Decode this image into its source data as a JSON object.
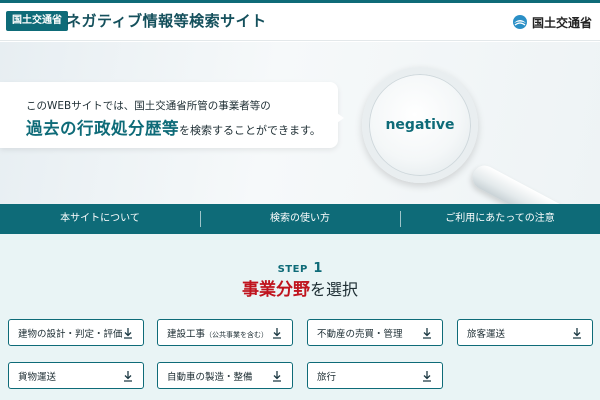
{
  "header": {
    "badge": "国土交通省",
    "site_title": "ネガティブ情報等検索サイト",
    "ministry_label": "国土交通省",
    "ministry_icon": "ministry-logo-icon"
  },
  "hero": {
    "line1": "このWEBサイトでは、国土交通省所管の事業者等の",
    "line2_strong": "過去の行政処分歴等",
    "line2_rest": "を検索することができます。",
    "lens_word": "negative"
  },
  "nav": {
    "items": [
      {
        "label": "本サイトについて"
      },
      {
        "label": "検索の使い方"
      },
      {
        "label": "ご利用にあたっての注意"
      }
    ]
  },
  "step": {
    "word": "STEP",
    "number": "1",
    "title_strong": "事業分野",
    "title_rest": "を選択"
  },
  "categories": [
    {
      "label": "建物の設計・判定・評価",
      "note": ""
    },
    {
      "label": "建設工事",
      "note": "（公共事業を含む）"
    },
    {
      "label": "不動産の売買・管理",
      "note": ""
    },
    {
      "label": "旅客運送",
      "note": ""
    },
    {
      "label": "貨物運送",
      "note": ""
    },
    {
      "label": "自動車の製造・整備",
      "note": ""
    },
    {
      "label": "旅行",
      "note": ""
    }
  ],
  "colors": {
    "accent": "#0e6b78",
    "emphasis": "#c0141e",
    "section_bg": "#e9f4f5"
  },
  "icons": {
    "category_button": "download-arrow-icon"
  }
}
